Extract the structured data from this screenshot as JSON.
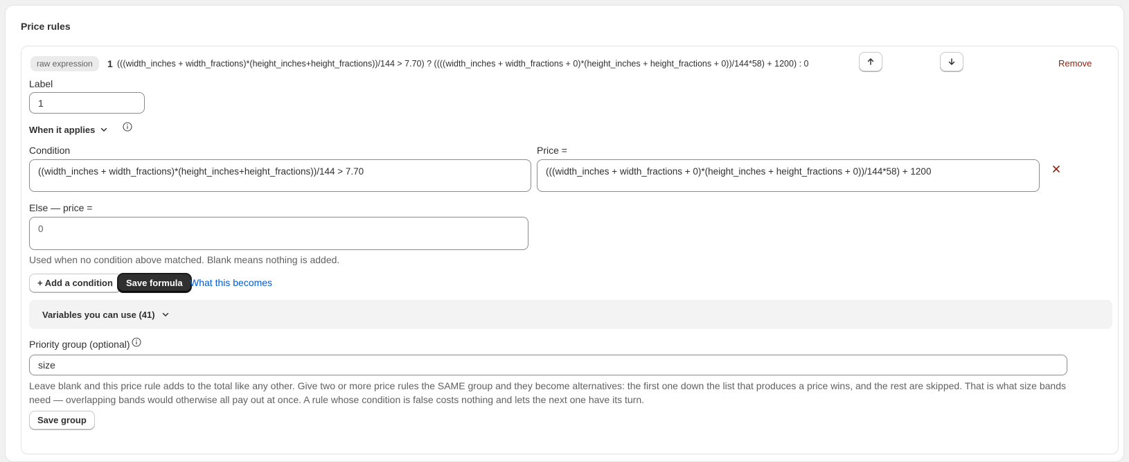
{
  "section_title": "Price rules",
  "rule": {
    "badge": "raw expression",
    "number": "1",
    "expression": "(((width_inches + width_fractions)*(height_inches+height_fractions))/144 > 7.70) ? ((((width_inches + width_fractions + 0)*(height_inches + height_fractions + 0))/144*58) + 1200) : 0",
    "remove_label": "Remove",
    "label_heading": "Label",
    "label_value": "1",
    "when_applies": "When it applies",
    "condition_heading": "Condition",
    "condition_value": "((width_inches + width_fractions)*(height_inches+height_fractions))/144 > 7.70",
    "price_heading": "Price =",
    "price_value": "(((width_inches + width_fractions + 0)*(height_inches + height_fractions + 0))/144*58) + 1200",
    "else_heading": "Else — price =",
    "else_value": "0",
    "else_help": "Used when no condition above matched. Blank means nothing is added.",
    "add_condition": "+ Add a condition",
    "save_formula": "Save formula",
    "what_becomes": "What this becomes",
    "variables_label": "Variables you can use (41)",
    "priority_heading": "Priority group (optional)",
    "priority_value": "size",
    "priority_help": "Leave blank and this price rule adds to the total like any other. Give two or more price rules the SAME group and they become alternatives: the first one down the list that produces a price wins, and the rest are skipped. That is what size bands need — overlapping bands would otherwise all pay out at once. A rule whose condition is false costs nothing and lets the next one have its turn.",
    "save_group": "Save group"
  },
  "icons": {
    "move_up": "arrow-up-icon",
    "move_down": "arrow-down-icon",
    "info": "info-icon",
    "chevron": "chevron-down-icon",
    "remove_condition": "close-icon"
  },
  "colors": {
    "primary_button": "#303030",
    "link": "#005bd3",
    "critical": "#8e1f0b"
  }
}
